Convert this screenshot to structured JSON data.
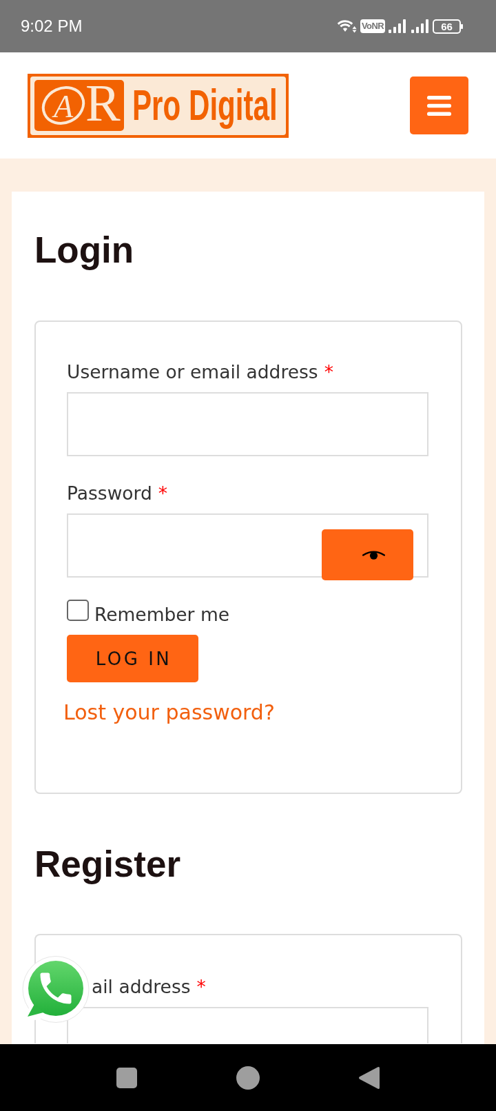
{
  "status_bar": {
    "time": "9:02 PM",
    "network_badge": "VoNR",
    "battery": "66"
  },
  "header": {
    "logo": {
      "monogram": "AR",
      "name": "Pro Digital"
    }
  },
  "login": {
    "title": "Login",
    "fields": [
      {
        "label": "Username or email address",
        "required_marker": "*",
        "kind": "text"
      },
      {
        "label": "Password",
        "required_marker": "*",
        "kind": "password"
      }
    ],
    "remember": {
      "label": "Remember me",
      "checked": false
    },
    "submit": "LOG IN",
    "lost_password": "Lost your password?"
  },
  "register": {
    "title": "Register",
    "fields": [
      {
        "label": "ail address",
        "required_marker": "*",
        "kind": "text"
      }
    ]
  }
}
